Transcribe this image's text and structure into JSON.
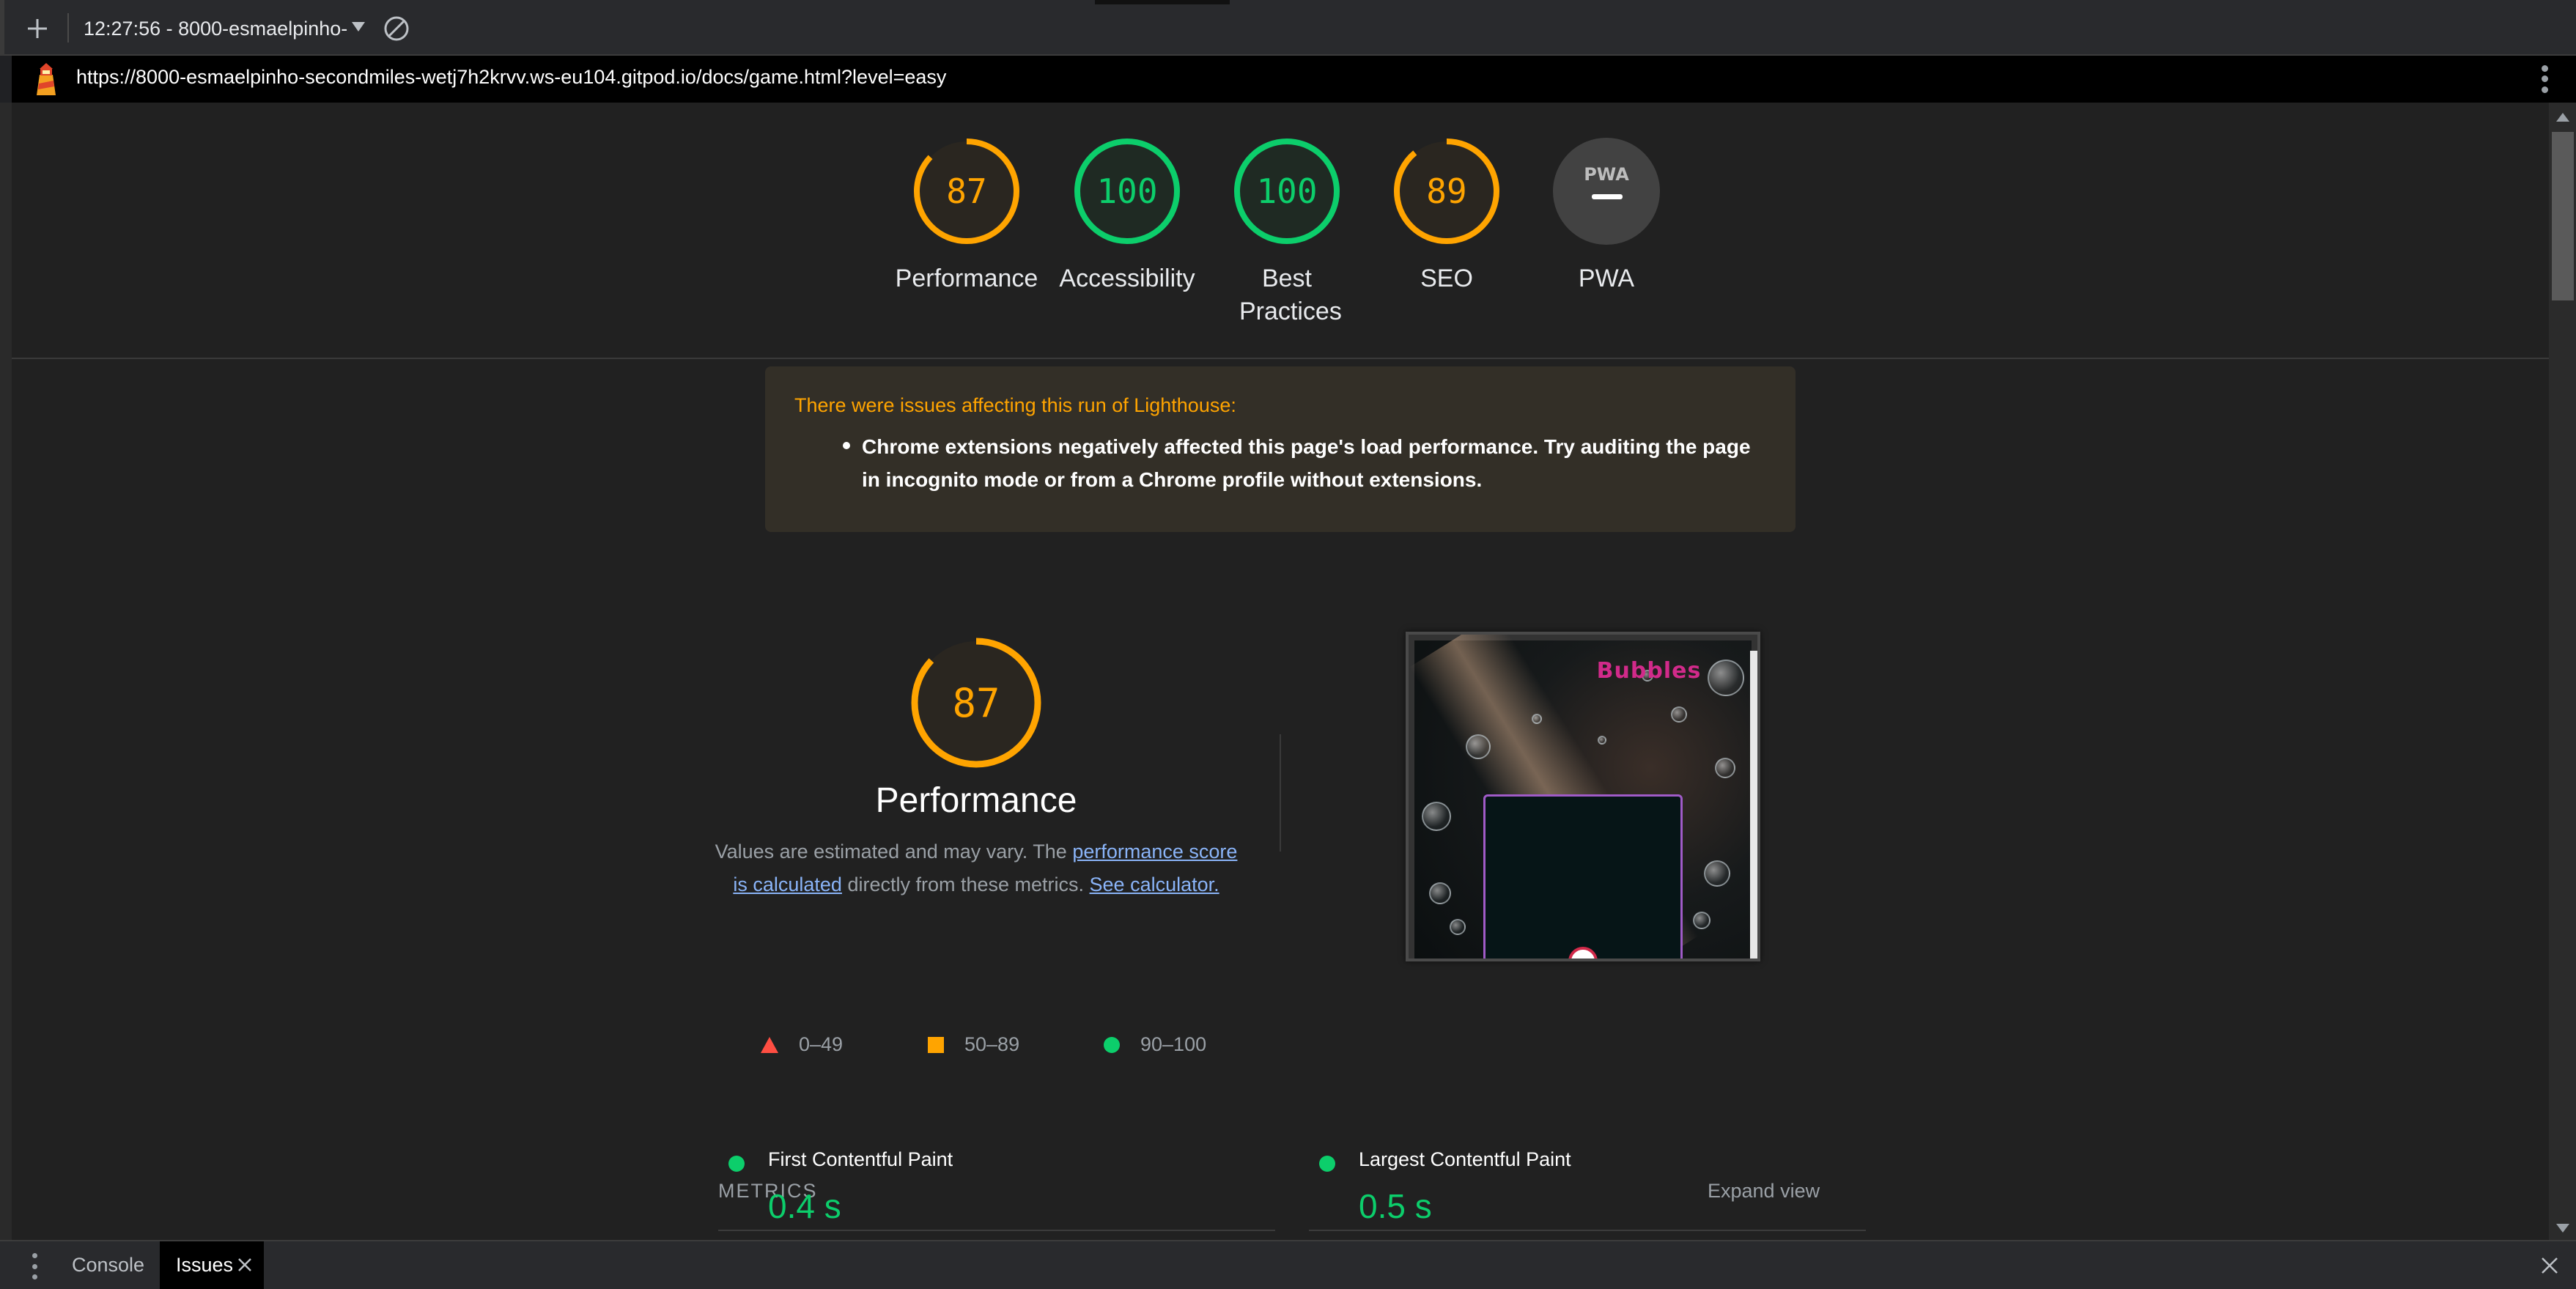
{
  "toolbar": {
    "report_label": "12:27:56 - 8000-esmaelpinho-s",
    "icons": [
      "plus-icon",
      "chevron-down-icon",
      "block-icon"
    ]
  },
  "urlbar": {
    "url": "https://8000-esmaelpinho-secondmiles-wetj7h2krvv.ws-eu104.gitpod.io/docs/game.html?level=easy",
    "icons": [
      "lighthouse-logo-icon",
      "kebab-menu-icon"
    ]
  },
  "scores": [
    {
      "label": "Performance",
      "value": "87",
      "fraction": 0.87,
      "color": "#ffa400"
    },
    {
      "label": "Accessibility",
      "value": "100",
      "fraction": 1.0,
      "color": "#0cce6b"
    },
    {
      "label": "Best Practices",
      "value": "100",
      "fraction": 1.0,
      "color": "#0cce6b"
    },
    {
      "label": "SEO",
      "value": "89",
      "fraction": 0.89,
      "color": "#ffa400"
    },
    {
      "label": "PWA",
      "value": "",
      "color": "#9aa0a6"
    }
  ],
  "pwa_badge": "PWA",
  "warnings": {
    "title": "There were issues affecting this run of Lighthouse:",
    "items": [
      "Chrome extensions negatively affected this page's load performance. Try auditing the page in incognito mode or from a Chrome profile without extensions."
    ]
  },
  "performance": {
    "score": "87",
    "fraction": 0.87,
    "title": "Performance",
    "desc_prefix": "Values are estimated and may vary. The ",
    "desc_link1": "performance score is calculated",
    "desc_middle": " directly from these metrics. ",
    "desc_link2": "See calculator.",
    "legend": [
      "0–49",
      "50–89",
      "90–100"
    ]
  },
  "thumbnail": {
    "title": "Bubbles"
  },
  "metrics": {
    "title": "METRICS",
    "expand": "Expand view",
    "items": [
      {
        "label": "First Contentful Paint",
        "value": "0.4 s"
      },
      {
        "label": "Largest Contentful Paint",
        "value": "0.5 s"
      }
    ]
  },
  "drawer": {
    "tabs": [
      "Console",
      "Issues"
    ]
  },
  "colors": {
    "average": "#ffa400",
    "pass": "#0cce6b",
    "fail": "#ff4e42",
    "background": "#212121"
  }
}
